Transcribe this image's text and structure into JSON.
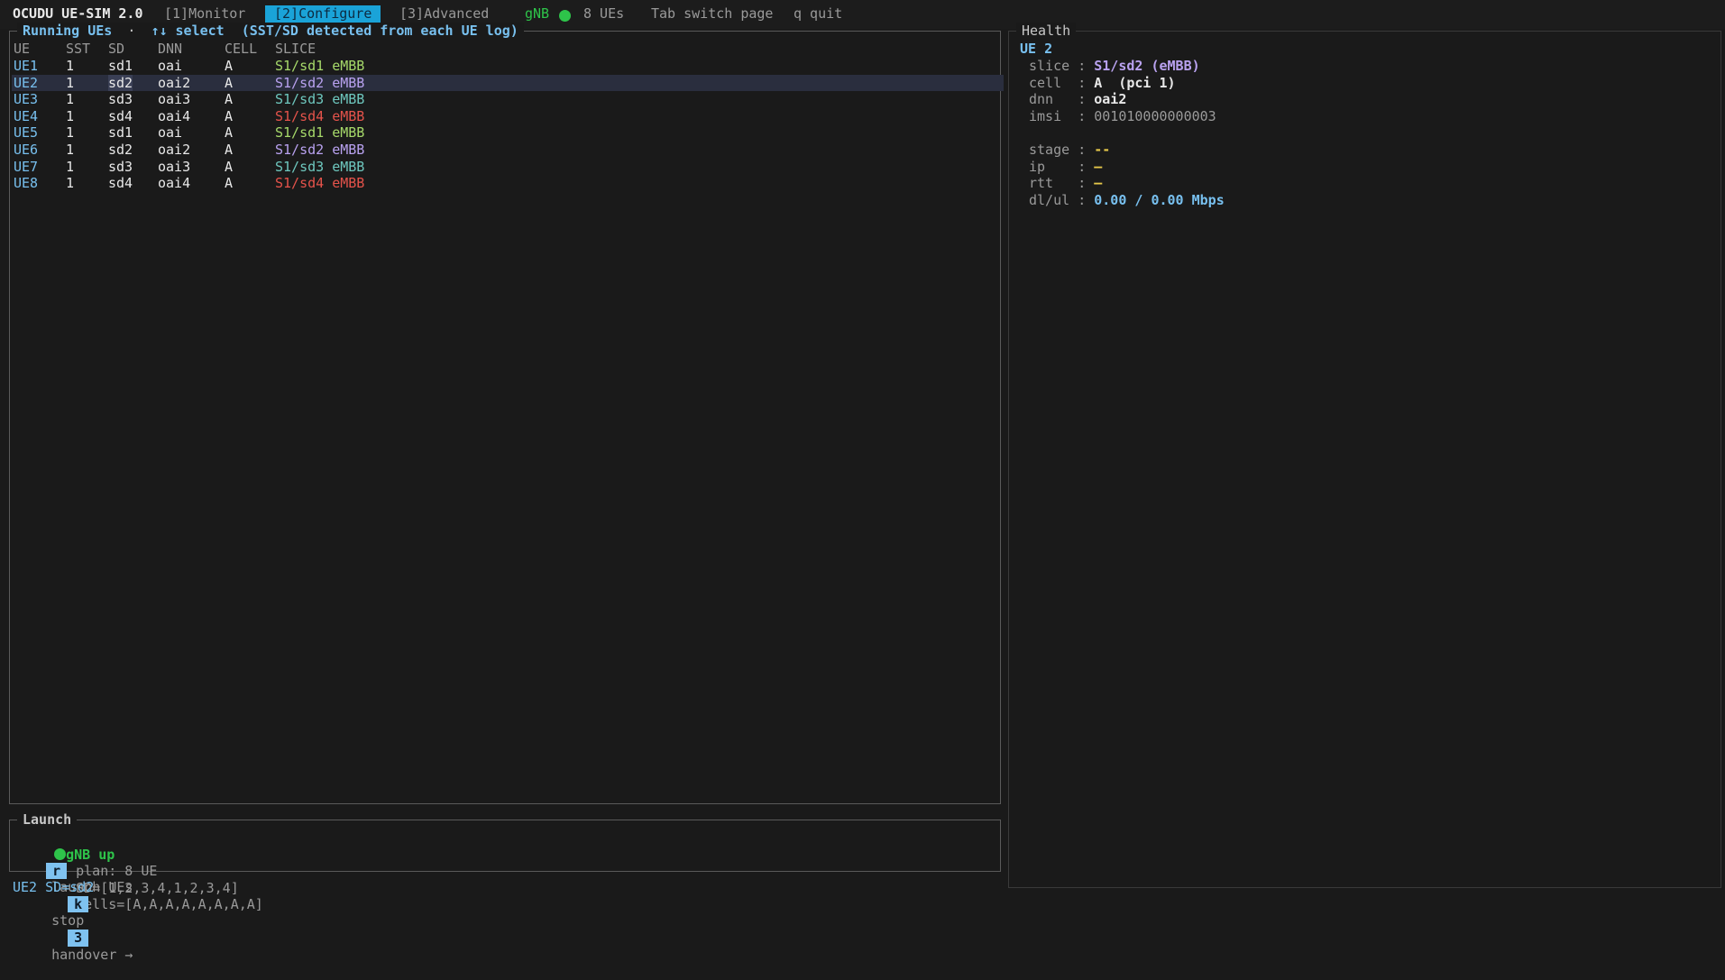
{
  "topbar": {
    "app_title": "OCUDU UE-SIM 2.0",
    "tabs": [
      {
        "label": "[1]Monitor",
        "active": false
      },
      {
        "label": "[2]Configure",
        "active": true
      },
      {
        "label": "[3]Advanced",
        "active": false
      }
    ],
    "gnb_label": "gNB",
    "ue_count": "8 UEs",
    "hint_tab": "Tab switch page",
    "hint_quit": "q quit"
  },
  "running_ues": {
    "title": "Running UEs",
    "separator": "·",
    "select_hint": "↑↓ select",
    "note": "(SST/SD detected from each UE log)",
    "columns": [
      "UE",
      "SST",
      "SD",
      "DNN",
      "CELL",
      "SLICE"
    ],
    "rows": [
      {
        "ue": "UE1",
        "sst": "1",
        "sd": "sd1",
        "dnn": "oai",
        "cell": "A",
        "slice": "S1/sd1 eMBB",
        "slice_color": "#a6d96a",
        "selected": false
      },
      {
        "ue": "UE2",
        "sst": "1",
        "sd": "sd2",
        "dnn": "oai2",
        "cell": "A",
        "slice": "S1/sd2 eMBB",
        "slice_color": "#b9a2f0",
        "selected": true
      },
      {
        "ue": "UE3",
        "sst": "1",
        "sd": "sd3",
        "dnn": "oai3",
        "cell": "A",
        "slice": "S1/sd3 eMBB",
        "slice_color": "#6ec7be",
        "selected": false
      },
      {
        "ue": "UE4",
        "sst": "1",
        "sd": "sd4",
        "dnn": "oai4",
        "cell": "A",
        "slice": "S1/sd4 eMBB",
        "slice_color": "#e5534b",
        "selected": false
      },
      {
        "ue": "UE5",
        "sst": "1",
        "sd": "sd1",
        "dnn": "oai",
        "cell": "A",
        "slice": "S1/sd1 eMBB",
        "slice_color": "#a6d96a",
        "selected": false
      },
      {
        "ue": "UE6",
        "sst": "1",
        "sd": "sd2",
        "dnn": "oai2",
        "cell": "A",
        "slice": "S1/sd2 eMBB",
        "slice_color": "#b9a2f0",
        "selected": false
      },
      {
        "ue": "UE7",
        "sst": "1",
        "sd": "sd3",
        "dnn": "oai3",
        "cell": "A",
        "slice": "S1/sd3 eMBB",
        "slice_color": "#6ec7be",
        "selected": false
      },
      {
        "ue": "UE8",
        "sst": "1",
        "sd": "sd4",
        "dnn": "oai4",
        "cell": "A",
        "slice": "S1/sd4 eMBB",
        "slice_color": "#e5534b",
        "selected": false
      }
    ]
  },
  "health": {
    "title": "Health",
    "ue_title": "UE 2",
    "fields": [
      {
        "label": "slice ",
        "value": "S1/sd2 (eMBB)",
        "color": "#b9a2f0"
      },
      {
        "label": "cell  ",
        "value": "A  (pci 1)",
        "color": "#e8e8e8"
      },
      {
        "label": "dnn   ",
        "value": "oai2",
        "color": "#e8e8e8"
      },
      {
        "label": "imsi  ",
        "value": "001010000000003",
        "color": "#9a9a9a"
      }
    ],
    "fields2": [
      {
        "label": "stage ",
        "value": "--",
        "color": "#e6c84a"
      },
      {
        "label": "ip    ",
        "value": "—",
        "color": "#e6c84a"
      },
      {
        "label": "rtt   ",
        "value": "—",
        "color": "#e6c84a"
      },
      {
        "label": "dl/ul ",
        "value": "0.00 / 0.00 Mbps",
        "color": "#78c0ef"
      }
    ]
  },
  "launch": {
    "title": "Launch",
    "gnb_status": "gNB up",
    "plan": "plan: 8 UE",
    "sd_list": "SD=[1,2,3,4,1,2,3,4]",
    "cells_list": "cells=[A,A,A,A,A,A,A,A]",
    "keys": [
      {
        "key": "r",
        "label": "launch UEs"
      },
      {
        "key": "k",
        "label": "stop"
      },
      {
        "key": "3",
        "label": "handover →"
      }
    ]
  },
  "statusline": "UE2 SD=sd2",
  "colors": {
    "accent": "#1aa3d8",
    "ok": "#2ec44a",
    "background": "#1a1a1a"
  }
}
